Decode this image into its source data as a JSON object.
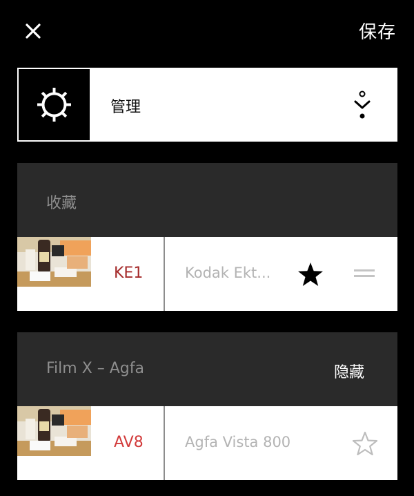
{
  "header": {
    "close_icon": "close-icon",
    "save_label": "保存"
  },
  "manage": {
    "label": "管理",
    "icon": "gear-icon",
    "sort_icon": "sort-icon"
  },
  "sections": [
    {
      "title": "收藏",
      "action_label": "",
      "rows": [
        {
          "code": "KE1",
          "code_color": "#a52a2a",
          "name": "Kodak Ekt...",
          "starred": true,
          "thumbnail": "film-photo-thumbnail"
        }
      ]
    },
    {
      "title": "Film X – Agfa",
      "action_label": "隐藏",
      "rows": [
        {
          "code": "AV8",
          "code_color": "#d23a3a",
          "name": "Agfa Vista 800",
          "starred": false,
          "thumbnail": "film-photo-thumbnail"
        }
      ]
    }
  ]
}
